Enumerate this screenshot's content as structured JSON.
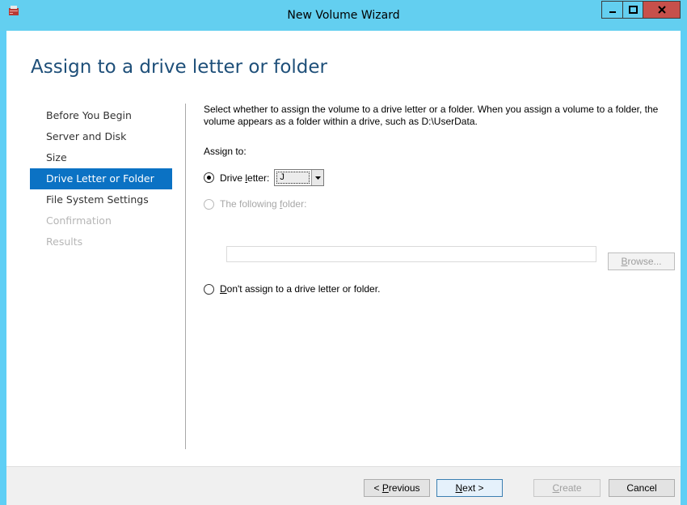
{
  "window": {
    "title": "New Volume Wizard"
  },
  "page": {
    "title": "Assign to a drive letter or folder"
  },
  "nav": {
    "items": [
      {
        "label": "Before You Begin",
        "state": "normal"
      },
      {
        "label": "Server and Disk",
        "state": "normal"
      },
      {
        "label": "Size",
        "state": "normal"
      },
      {
        "label": "Drive Letter or Folder",
        "state": "active"
      },
      {
        "label": "File System Settings",
        "state": "normal"
      },
      {
        "label": "Confirmation",
        "state": "disabled"
      },
      {
        "label": "Results",
        "state": "disabled"
      }
    ]
  },
  "content": {
    "description": "Select whether to assign the volume to a drive letter or a folder. When you assign a volume to a folder, the volume appears as a folder within a drive, such as D:\\UserData.",
    "assign_to_label": "Assign to:",
    "drive_letter": {
      "label_pre": "Drive ",
      "label_u": "l",
      "label_post": "etter:",
      "value": "J",
      "selected": true
    },
    "folder": {
      "label_pre": "The following ",
      "label_u": "f",
      "label_post": "older:",
      "value": "",
      "enabled": false
    },
    "browse_button": {
      "label_u": "B",
      "label_post": "rowse...",
      "enabled": false
    },
    "no_assign": {
      "label_u": "D",
      "label_post": "on't assign to a drive letter or folder."
    }
  },
  "footer": {
    "previous": {
      "pre": "< ",
      "u": "P",
      "post": "revious"
    },
    "next": {
      "u": "N",
      "post": "ext >"
    },
    "create": {
      "u": "C",
      "post": "reate",
      "enabled": false
    },
    "cancel": "Cancel"
  },
  "colors": {
    "titlebar": "#63cff0",
    "accent": "#0b72c4",
    "title_text": "#1e4f79",
    "close_button": "#c7504b"
  }
}
